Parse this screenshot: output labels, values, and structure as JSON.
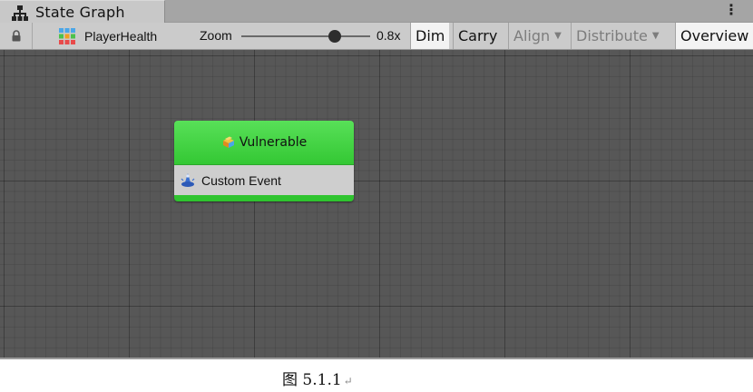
{
  "window": {
    "tab_title": "State Graph",
    "tab_icon": "state-graph-icon",
    "menu_icon": "kebab-menu-icon"
  },
  "toolbar": {
    "lock_icon": "lock-icon",
    "asset_icon": "state-machine-asset-icon",
    "asset_name": "PlayerHealth",
    "zoom_label": "Zoom",
    "zoom_value": "0.8x",
    "buttons": {
      "dim": "Dim",
      "carry": "Carry",
      "align": "Align",
      "distribute": "Distribute",
      "overview": "Overview"
    }
  },
  "graph": {
    "state_node": {
      "title": "Vulnerable",
      "title_icon": "state-icon",
      "header_color": "#3ed43e",
      "events": [
        {
          "icon": "custom-event-icon",
          "label": "Custom Event"
        }
      ]
    }
  },
  "caption": {
    "text": "图 5.1.1",
    "return_mark": "↵"
  },
  "colors": {
    "canvas": "#575757",
    "toolbar": "#cbcbcb",
    "active_button": "#f3f3f3",
    "node_green": "#3ed43e"
  }
}
